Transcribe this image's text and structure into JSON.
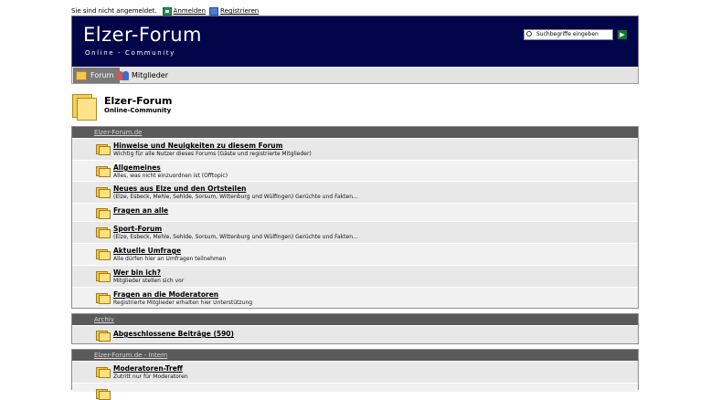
{
  "top": {
    "status": "Sie sind nicht angemeldet.",
    "login": "Anmelden",
    "register": "Registrieren"
  },
  "header": {
    "title": "Elzer-Forum",
    "subtitle": "Online - Community",
    "search_placeholder": "Suchbegriffe eingeben",
    "go_icon": "arrow-right-icon"
  },
  "nav": {
    "tabs": [
      {
        "label": "Forum",
        "icon": "folder-icon"
      },
      {
        "label": "Mitglieder",
        "icon": "members-icon"
      }
    ]
  },
  "page": {
    "title": "Elzer-Forum",
    "subtitle": "Online-Community"
  },
  "categories": [
    {
      "name": "Elzer-Forum.de",
      "boards": [
        {
          "name": "Hinweise und Neuigkeiten zu diesem Forum",
          "desc": "Wichtig für alle Nutzer dieses Forums (Gäste und registrierte Mitglieder)"
        },
        {
          "name": "Allgemeines",
          "desc": "Alles, was nicht einzuordnen ist (Offtopic)"
        },
        {
          "name": "Neues aus Elze und den Ortsteilen",
          "desc": "(Elze, Esbeck, Mehle, Sehlde, Sorsum, Wittenburg und Wülfingen) Gerüchte und Fakten..."
        },
        {
          "name": "Fragen an alle",
          "desc": ""
        },
        {
          "name": "Sport-Forum",
          "desc": "(Elze, Esbeck, Mehle, Sehlde, Sorsum, Wittenburg und Wülfingen) Gerüchte und Fakten..."
        },
        {
          "name": "Aktuelle Umfrage",
          "desc": "Alle dürfen hier an Umfragen teilnehmen"
        },
        {
          "name": "Wer bin ich?",
          "desc": "Mitglieder stellen sich vor"
        },
        {
          "name": "Fragen an die Moderatoren",
          "desc": "Registrierte Mitglieder erhalten hier Unterstützung"
        }
      ]
    },
    {
      "name": "Archiv",
      "boards": [
        {
          "name": "Abgeschlossene Beiträge (590)",
          "desc": ""
        }
      ]
    },
    {
      "name": "Elzer-Forum.de - Intern",
      "boards": [
        {
          "name": "Moderatoren-Treff",
          "desc": "Zutritt nur für Moderatoren"
        }
      ]
    }
  ]
}
